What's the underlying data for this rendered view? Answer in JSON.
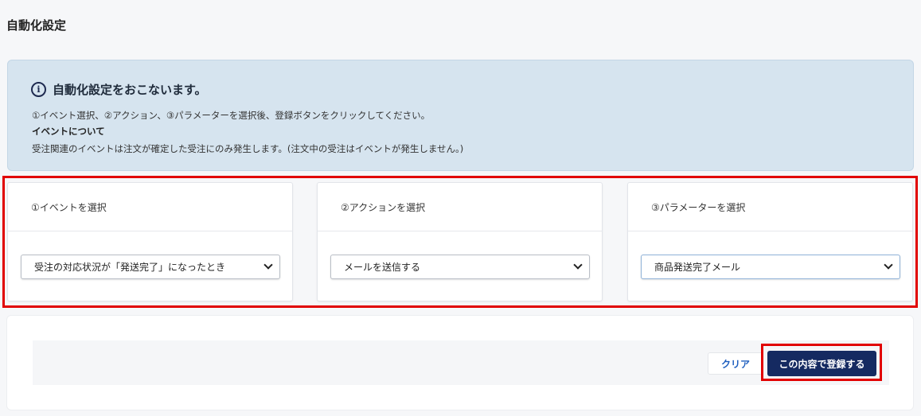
{
  "page": {
    "title": "自動化設定"
  },
  "info": {
    "icon": "info-circle-icon",
    "heading": "自動化設定をおこないます。",
    "line1": "①イベント選択、②アクション、③パラメーターを選択後、登録ボタンをクリックしてください。",
    "line2": "イベントについて",
    "line3": "受注関連のイベントは注文が確定した受注にのみ発生します。(注文中の受注はイベントが発生しません。)"
  },
  "panels": [
    {
      "header": "①イベントを選択",
      "selected": "受注の対応状況が「発送完了」になったとき"
    },
    {
      "header": "②アクションを選択",
      "selected": "メールを送信する"
    },
    {
      "header": "③パラメーターを選択",
      "selected": "商品発送完了メール"
    }
  ],
  "actions": {
    "clear_label": "クリア",
    "submit_label": "この内容で登録する"
  },
  "colors": {
    "info_bg": "#d6e4ef",
    "submit_bg": "#152a61",
    "clear_text": "#1f5fbf",
    "highlight": "#e10000"
  }
}
